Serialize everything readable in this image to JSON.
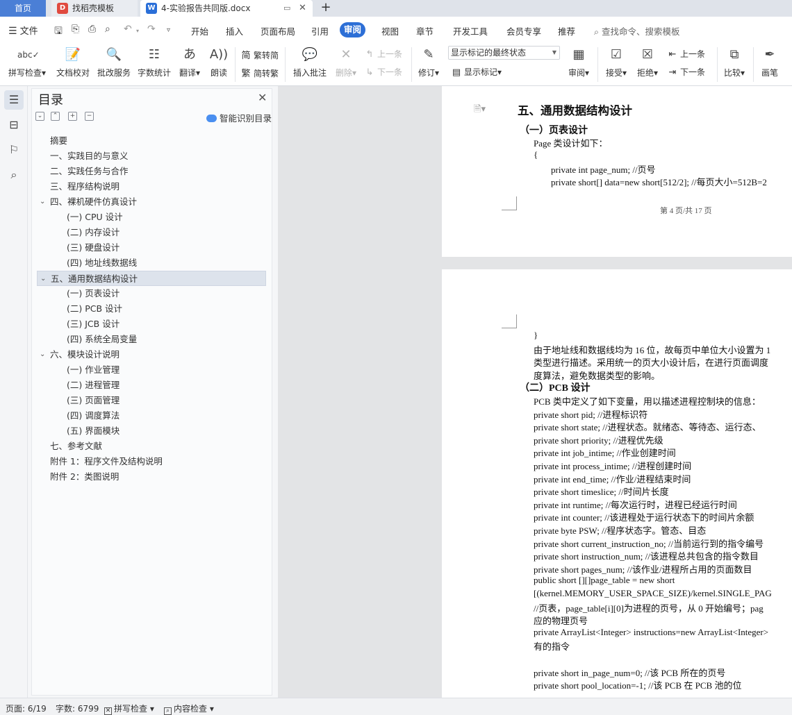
{
  "tabs": {
    "home": "首页",
    "templates": "找稻壳模板",
    "document": "4-实验报告共同版.docx"
  },
  "menu": {
    "file": "文件",
    "tabs": [
      "开始",
      "插入",
      "页面布局",
      "引用",
      "审阅",
      "视图",
      "章节",
      "开发工具",
      "会员专享",
      "推荐"
    ],
    "active_tab": "审阅",
    "search": "查找命令、搜索模板"
  },
  "ribbon": {
    "spell_check": "拼写检查",
    "doc_proofread": "文档校对",
    "batch_service": "批改服务",
    "word_count": "字数统计",
    "translate": "翻译",
    "read_aloud": "朗读",
    "trad_to_simp": "繁转简",
    "simp_to_trad": "简转繁",
    "insert_comment": "插入批注",
    "delete": "删除",
    "prev_comment": "上一条",
    "next_comment": "下一条",
    "track_changes": "修订",
    "markup_select": "显示标记的最终状态",
    "show_markup": "显示标记",
    "review": "审阅",
    "accept": "接受",
    "reject": "拒绝",
    "prev_change": "上一条",
    "next_change": "下一条",
    "compare": "比较",
    "pen": "画笔"
  },
  "toc": {
    "title": "目录",
    "smart_toc": "智能识别目录",
    "items": [
      {
        "text": "摘要",
        "level": 1
      },
      {
        "text": "一、实践目的与意义",
        "level": 1
      },
      {
        "text": "二、实践任务与合作",
        "level": 1
      },
      {
        "text": "三、程序结构说明",
        "level": 1
      },
      {
        "text": "四、裸机硬件仿真设计",
        "level": 1,
        "expanded": true
      },
      {
        "text": "(一) CPU 设计",
        "level": 2
      },
      {
        "text": "(二) 内存设计",
        "level": 2
      },
      {
        "text": "(三) 硬盘设计",
        "level": 2
      },
      {
        "text": "(四) 地址线数据线",
        "level": 2
      },
      {
        "text": "五、通用数据结构设计",
        "level": 1,
        "expanded": true,
        "selected": true
      },
      {
        "text": "(一) 页表设计",
        "level": 2
      },
      {
        "text": "(二) PCB 设计",
        "level": 2
      },
      {
        "text": "(三) JCB 设计",
        "level": 2
      },
      {
        "text": "(四) 系统全局变量",
        "level": 2
      },
      {
        "text": "六、模块设计说明",
        "level": 1,
        "expanded": true
      },
      {
        "text": "(一) 作业管理",
        "level": 2
      },
      {
        "text": "(二) 进程管理",
        "level": 2
      },
      {
        "text": "(三) 页面管理",
        "level": 2
      },
      {
        "text": "(四) 调度算法",
        "level": 2
      },
      {
        "text": "(五) 界面模块",
        "level": 2
      },
      {
        "text": "七、参考文献",
        "level": 1
      },
      {
        "text": "附件 1：程序文件及结构说明",
        "level": 1
      },
      {
        "text": "附件 2：类图说明",
        "level": 1
      }
    ]
  },
  "document": {
    "page1": {
      "heading": "五、通用数据结构设计",
      "subheading": "（一）页表设计",
      "lines": [
        "Page 类设计如下：",
        "{",
        "private int page_num;      //页号",
        "private short[] data=new short[512/2];  //每页大小=512B=2"
      ],
      "footer": "第 4 页/共 17 页"
    },
    "page2": {
      "intro_lines": [
        "}",
        "由于地址线和数据线均为 16 位，故每页中单位大小设置为 1",
        "类型进行描述。采用统一的页大小设计后，在进行页面调度",
        "度算法，避免数据类型的影响。"
      ],
      "subheading": "（二）PCB 设计",
      "lines": [
        "PCB 类中定义了如下变量，用以描述进程控制块的信息：",
        "private short pid;       //进程标识符",
        "private short state;     //进程状态。就绪态、等待态、运行态、",
        "private short priority; //进程优先级",
        "private int job_intime;      //作业创建时间",
        "private int process_intime;      //进程创建时间",
        "private int end_time;  //作业/进程结束时间",
        "private short timeslice;     //时间片长度",
        "private int runtime;    //每次运行时，进程已经运行时间",
        "private int counter;     //该进程处于运行状态下的时间片余额",
        "private byte PSW;            //程序状态字。管态、目态",
        "private short current_instruction_no;    //当前运行到的指令编号",
        "private short instruction_num; //该进程总共包含的指令数目",
        "private short pages_num;  //该作业/进程所占用的页面数目",
        "public short [][]page_table = new short",
        "[(kernel.MEMORY_USER_SPACE_SIZE)/kernel.SINGLE_PAG",
        "//页表，page_table[i][0]为进程的页号，从 0 开始编号；pag",
        "应的物理页号",
        "private ArrayList<Integer> instructions=new ArrayList<Integer>",
        "有的指令",
        "",
        "private short in_page_num=0;       //该 PCB 所在的页号",
        "private short pool_location=-1;            //该 PCB 在 PCB 池的位"
      ]
    }
  },
  "status": {
    "page": "页面: 6/19",
    "word_count": "字数: 6799",
    "spell_check": "拼写检查",
    "content_check": "内容检查"
  }
}
